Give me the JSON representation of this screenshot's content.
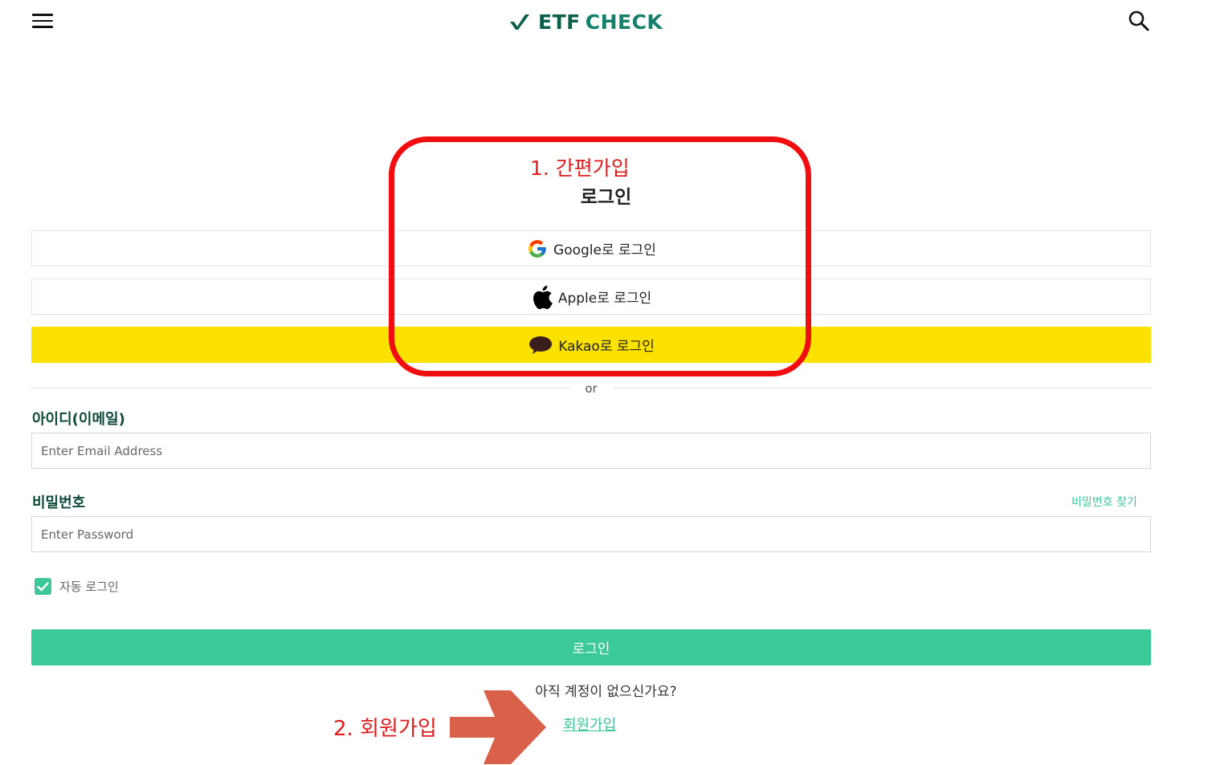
{
  "header": {
    "logo_part1": "ETF",
    "logo_part2": "CHECK",
    "menu_icon": "hamburger-menu-icon",
    "search_icon": "search-icon"
  },
  "annotations": {
    "step1": "1. 간편가입",
    "step2": "2. 회원가입",
    "highlight_color": "#f10e10",
    "arrow_color": "#d9614a"
  },
  "login": {
    "title": "로그인",
    "google_label": "Google로 로그인",
    "apple_label": "Apple로 로그인",
    "kakao_label": "Kakao로 로그인",
    "kakao_color": "#fae100",
    "or_text": "or",
    "email_label": "아이디(이메일)",
    "email_placeholder": "Enter Email Address",
    "email_value": "",
    "password_label": "비밀번호",
    "password_placeholder": "Enter Password",
    "password_value": "",
    "find_password": "비밀번호 찾기",
    "auto_login_label": "자동 로그인",
    "auto_login_checked": true,
    "submit_label": "로그인",
    "accent_color": "#3cc999",
    "no_account_text": "아직 계정이 없으신가요?",
    "signup_link": "회원가입"
  }
}
